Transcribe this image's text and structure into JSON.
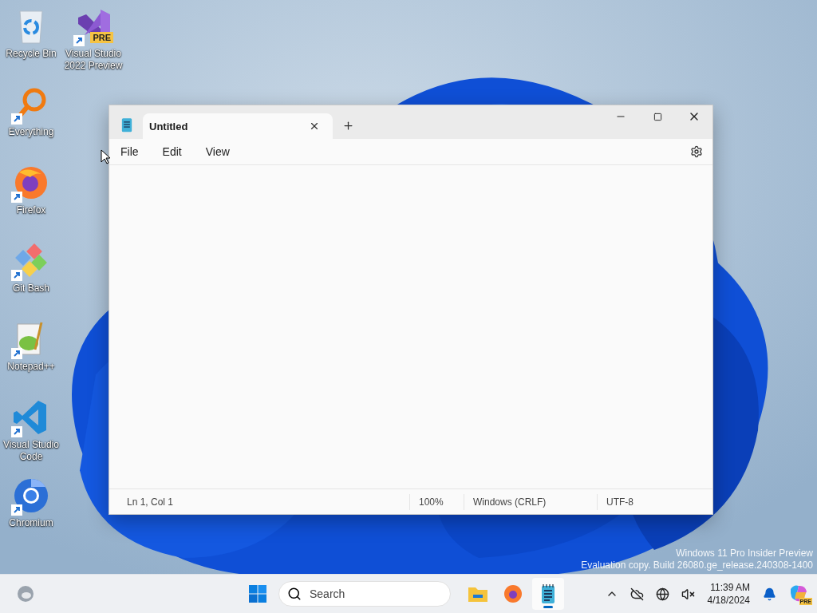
{
  "desktop": {
    "icons": [
      {
        "kind": "bin",
        "label": "Recycle Bin",
        "shortcut": false
      },
      {
        "kind": "magnifier",
        "label": "Everything",
        "shortcut": true
      },
      {
        "kind": "fox",
        "label": "Firefox",
        "shortcut": true
      },
      {
        "kind": "git",
        "label": "Git Bash",
        "shortcut": true
      },
      {
        "kind": "notepadpp",
        "label": "Notepad++",
        "shortcut": true
      },
      {
        "kind": "vscode",
        "label": "Visual Studio Code",
        "shortcut": true
      },
      {
        "kind": "chromium",
        "label": "Chromium",
        "shortcut": true
      },
      {
        "kind": "vs",
        "label": "Visual Studio 2022 Preview",
        "shortcut": true,
        "badge": "PRE"
      }
    ],
    "watermark": [
      "Windows 11 Pro Insider Preview",
      "Evaluation copy. Build 26080.ge_release.240308-1400"
    ]
  },
  "window": {
    "tabs": [
      {
        "title": "Untitled",
        "selected": true
      }
    ],
    "menu": [
      "File",
      "Edit",
      "View"
    ],
    "status_bar": [
      "Ln 1, Col 1",
      "100%",
      "Windows (CRLF)",
      "UTF-8"
    ]
  },
  "taskbar": {
    "search": {
      "placeholder": "Search"
    },
    "apps": [
      {
        "kind": "explorer",
        "active": false
      },
      {
        "kind": "fox",
        "active": false
      },
      {
        "kind": "notepad",
        "active": true
      }
    ],
    "clock": {
      "time": "11:39 AM",
      "date": "4/18/2024"
    },
    "copilot": {
      "badge": "PRE"
    }
  }
}
